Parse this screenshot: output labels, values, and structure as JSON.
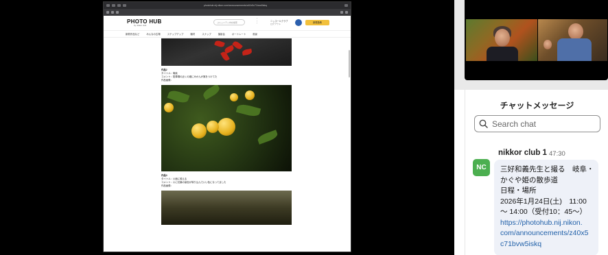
{
  "browser": {
    "url": "photohub.nij.nikon.com/announcements/z40x5c71bvw5iskq"
  },
  "site": {
    "logo": "PHOTO HUB",
    "logo_sub": "by nikkor club",
    "search_placeholder": "コミュニティ内を検索",
    "user_name": "ニッコールクラブ",
    "user_sub": "ログアウト",
    "post_button": "新規投稿",
    "nav": [
      "新着作品など",
      "みんなの広場",
      "ステップアップ",
      "機材",
      "スナップ",
      "撮影会",
      "ポートレート",
      "風景"
    ]
  },
  "entries": [
    {
      "title": "作品2",
      "line1": "タイトル：晩秋",
      "line2": "コメント：駐車場の近くの畑にみかんが実をつけてた",
      "line3": "作品画像："
    },
    {
      "title": "作品3",
      "line1": "タイトル：川面に映える",
      "line2": "コメント：川に紅葉の景色が映り込んでいい色になってました",
      "line3": "作品画像："
    }
  ],
  "chat": {
    "title": "チャットメッセージ",
    "search_placeholder": "Search chat",
    "message": {
      "avatar_initials": "NC",
      "sender": "nikkor club 1",
      "time": "47:30",
      "lines": [
        "三好和義先生と撮る　岐阜・",
        "かぐや姫の散歩道",
        "日程・場所",
        "2026年1月24日(土)　11:00",
        "～ 14:00（受付10：45～）"
      ],
      "link_lines": [
        "https://photohub.nij.nikon.",
        "com/announcements/z40x5",
        "c71bvw5iskq"
      ]
    }
  },
  "colors": {
    "avatar_bg": "#4caf50",
    "link": "#1f5fa8",
    "bubble_bg": "#eef1f8",
    "post_button_bg": "#f2c03b"
  }
}
